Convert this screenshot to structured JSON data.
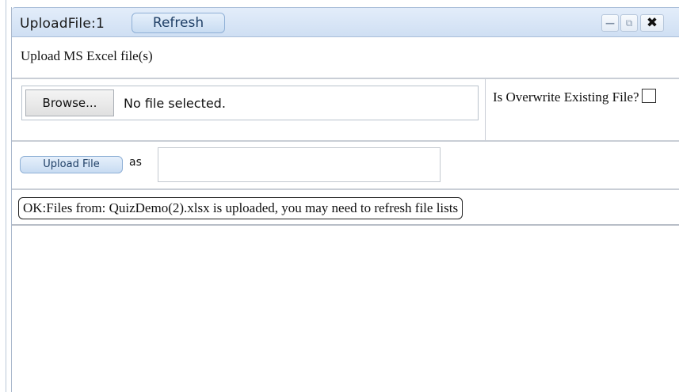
{
  "window": {
    "title": "UploadFile:1",
    "refresh_label": "Refresh",
    "minimize_icon": "minimize-icon",
    "popout_icon": "popout-icon",
    "close_icon": "close-icon"
  },
  "form": {
    "heading": "Upload MS Excel file(s)",
    "browse_label": "Browse...",
    "file_status": "No file selected.",
    "overwrite_label": "Is Overwrite Existing File?",
    "overwrite_checked": false,
    "upload_label": "Upload File",
    "as_label": "as",
    "as_value": ""
  },
  "status": {
    "message": "OK:Files from: QuizDemo(2).xlsx is uploaded, you may need to refresh file lists"
  }
}
